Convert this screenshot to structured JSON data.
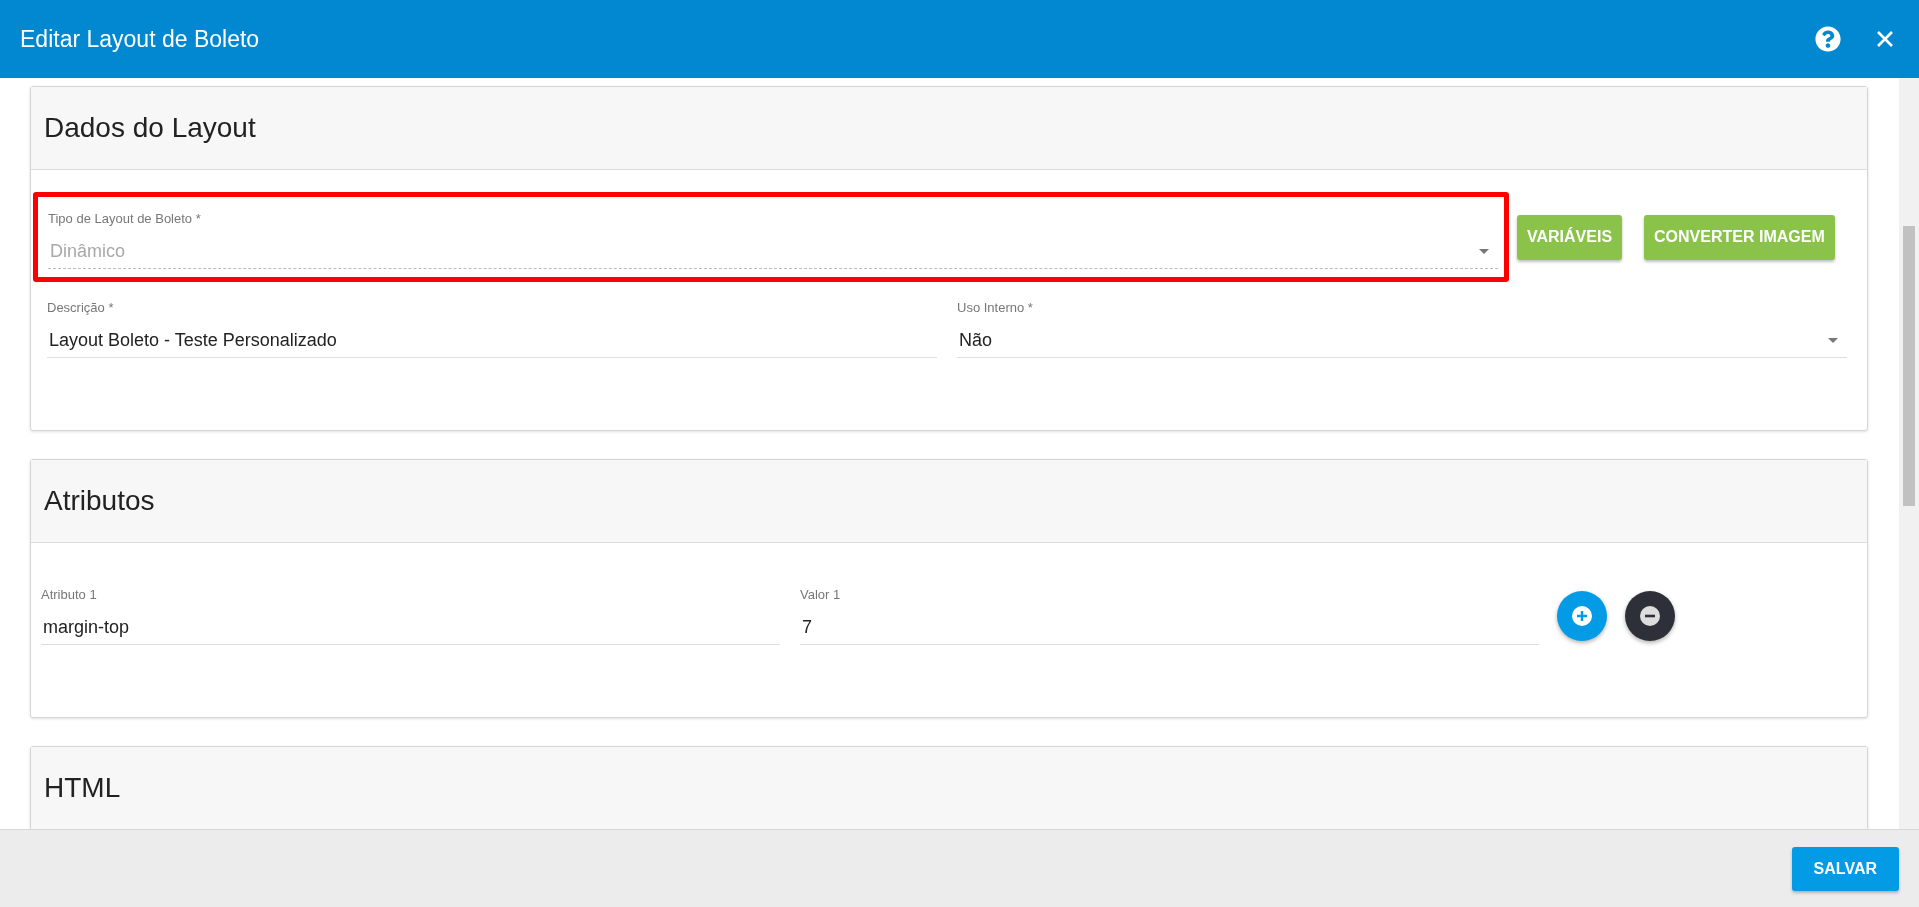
{
  "window": {
    "title": "Editar Layout de Boleto"
  },
  "layout_data": {
    "title": "Dados do Layout",
    "type_field": {
      "label": "Tipo de Layout de Boleto *",
      "value": "Dinâmico",
      "disabled": true,
      "highlighted": true
    },
    "buttons": [
      "VARIÁVEIS",
      "CONVERTER IMAGEM"
    ],
    "fields": [
      {
        "kind": "text",
        "label": "Descrição *",
        "value": "Layout Boleto - Teste Personalizado"
      },
      {
        "kind": "select",
        "label": "Uso Interno *",
        "value": "Não"
      }
    ]
  },
  "attributes": {
    "title": "Atributos",
    "rows": [
      {
        "attribute_label": "Atributo 1",
        "attribute_value": "margin-top",
        "value_label": "Valor 1",
        "value": "7"
      }
    ]
  },
  "html": {
    "title": "HTML"
  },
  "footer": {
    "save_button": "SALVAR"
  }
}
